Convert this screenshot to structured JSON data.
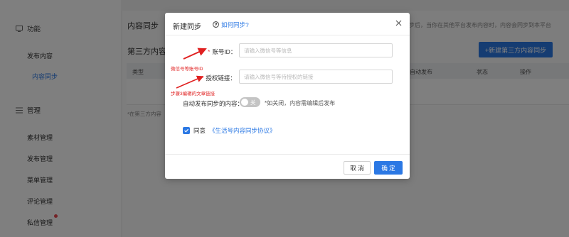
{
  "sidebar": {
    "group_function": "功能",
    "group_function_icon": "screen-icon",
    "publish_content": "发布内容",
    "content_sync": "内容同步",
    "group_manage": "管理",
    "group_manage_icon": "menu-lines-icon",
    "items": [
      "素材管理",
      "发布管理",
      "菜单管理",
      "评论管理",
      "私信管理"
    ]
  },
  "page": {
    "title": "内容同步",
    "hint": "步后，当你在其他平台发布内容时，内容会同步到本平台",
    "third_party_title": "第三方内容",
    "new_button": "+新建第三方内容同步",
    "table_headers": [
      "类型",
      "自动发布",
      "状态",
      "操作"
    ],
    "note": "*在第三方内容"
  },
  "modal": {
    "title": "新建同步",
    "help_link": "如何同步?",
    "help_icon": "question-circle-icon",
    "close_icon": "close-icon",
    "fields": {
      "account_id": {
        "label": "账号ID：",
        "placeholder": "请输入微信号等信息",
        "value": ""
      },
      "auth_link": {
        "label": "授权链接：",
        "placeholder": "请输入微信号等待授权的链接",
        "value": ""
      }
    },
    "auto_publish": {
      "label": "自动发布同步的内容：",
      "state": "关",
      "enabled": false,
      "hint": "*如关闭，内容需编辑后发布"
    },
    "agreement": {
      "checked": true,
      "prefix": "同意",
      "link": "《生活号内容同步协议》"
    },
    "cancel": "取 消",
    "confirm": "确 定"
  },
  "annotations": {
    "account": "微信号等账号ID",
    "auth": "步骤3编辑的文章链接"
  },
  "colors": {
    "primary": "#2b78e4",
    "danger": "#e8464f",
    "annotation": "#e02020"
  }
}
